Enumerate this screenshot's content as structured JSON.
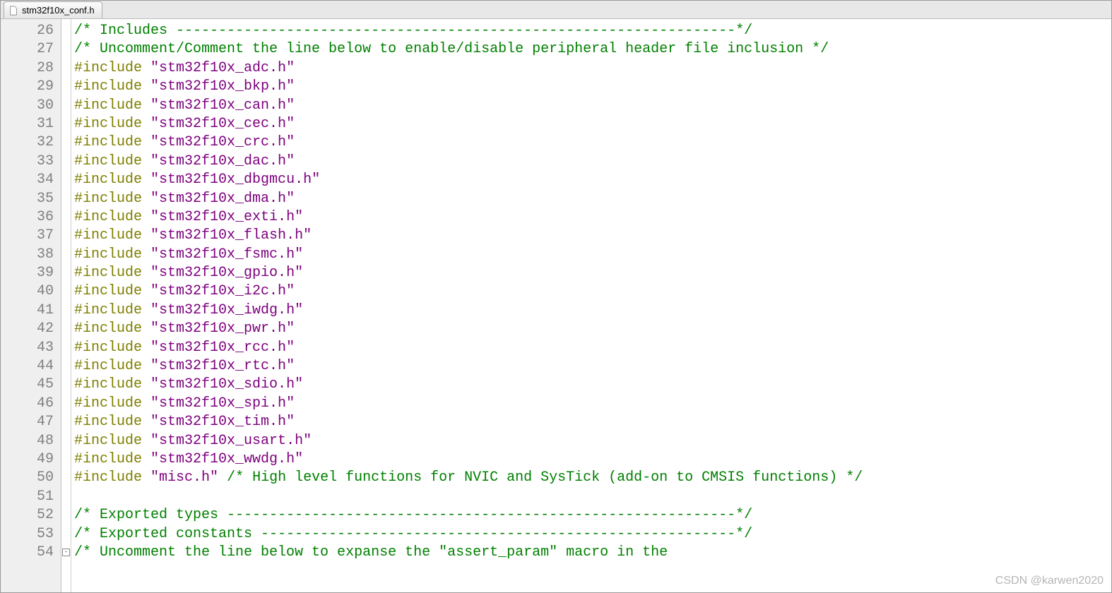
{
  "tab": {
    "filename": "stm32f10x_conf.h"
  },
  "watermark": "CSDN @karwen2020",
  "first_line_number": 26,
  "fold_marker_line": 54,
  "code_lines": [
    {
      "n": 26,
      "tokens": [
        {
          "c": "comment",
          "t": "/* Includes ------------------------------------------------------------------*/"
        }
      ]
    },
    {
      "n": 27,
      "tokens": [
        {
          "c": "comment",
          "t": "/* Uncomment/Comment the line below to enable/disable peripheral header file inclusion */"
        }
      ]
    },
    {
      "n": 28,
      "tokens": [
        {
          "c": "dir",
          "t": "#include "
        },
        {
          "c": "str",
          "t": "\"stm32f10x_adc.h\""
        }
      ]
    },
    {
      "n": 29,
      "tokens": [
        {
          "c": "dir",
          "t": "#include "
        },
        {
          "c": "str",
          "t": "\"stm32f10x_bkp.h\""
        }
      ]
    },
    {
      "n": 30,
      "tokens": [
        {
          "c": "dir",
          "t": "#include "
        },
        {
          "c": "str",
          "t": "\"stm32f10x_can.h\""
        }
      ]
    },
    {
      "n": 31,
      "tokens": [
        {
          "c": "dir",
          "t": "#include "
        },
        {
          "c": "str",
          "t": "\"stm32f10x_cec.h\""
        }
      ]
    },
    {
      "n": 32,
      "tokens": [
        {
          "c": "dir",
          "t": "#include "
        },
        {
          "c": "str",
          "t": "\"stm32f10x_crc.h\""
        }
      ]
    },
    {
      "n": 33,
      "tokens": [
        {
          "c": "dir",
          "t": "#include "
        },
        {
          "c": "str",
          "t": "\"stm32f10x_dac.h\""
        }
      ]
    },
    {
      "n": 34,
      "tokens": [
        {
          "c": "dir",
          "t": "#include "
        },
        {
          "c": "str",
          "t": "\"stm32f10x_dbgmcu.h\""
        }
      ]
    },
    {
      "n": 35,
      "tokens": [
        {
          "c": "dir",
          "t": "#include "
        },
        {
          "c": "str",
          "t": "\"stm32f10x_dma.h\""
        }
      ]
    },
    {
      "n": 36,
      "tokens": [
        {
          "c": "dir",
          "t": "#include "
        },
        {
          "c": "str",
          "t": "\"stm32f10x_exti.h\""
        }
      ]
    },
    {
      "n": 37,
      "tokens": [
        {
          "c": "dir",
          "t": "#include "
        },
        {
          "c": "str",
          "t": "\"stm32f10x_flash.h\""
        }
      ]
    },
    {
      "n": 38,
      "tokens": [
        {
          "c": "dir",
          "t": "#include "
        },
        {
          "c": "str",
          "t": "\"stm32f10x_fsmc.h\""
        }
      ]
    },
    {
      "n": 39,
      "tokens": [
        {
          "c": "dir",
          "t": "#include "
        },
        {
          "c": "str",
          "t": "\"stm32f10x_gpio.h\""
        }
      ]
    },
    {
      "n": 40,
      "tokens": [
        {
          "c": "dir",
          "t": "#include "
        },
        {
          "c": "str",
          "t": "\"stm32f10x_i2c.h\""
        }
      ]
    },
    {
      "n": 41,
      "tokens": [
        {
          "c": "dir",
          "t": "#include "
        },
        {
          "c": "str",
          "t": "\"stm32f10x_iwdg.h\""
        }
      ]
    },
    {
      "n": 42,
      "tokens": [
        {
          "c": "dir",
          "t": "#include "
        },
        {
          "c": "str",
          "t": "\"stm32f10x_pwr.h\""
        }
      ]
    },
    {
      "n": 43,
      "tokens": [
        {
          "c": "dir",
          "t": "#include "
        },
        {
          "c": "str",
          "t": "\"stm32f10x_rcc.h\""
        }
      ]
    },
    {
      "n": 44,
      "tokens": [
        {
          "c": "dir",
          "t": "#include "
        },
        {
          "c": "str",
          "t": "\"stm32f10x_rtc.h\""
        }
      ]
    },
    {
      "n": 45,
      "tokens": [
        {
          "c": "dir",
          "t": "#include "
        },
        {
          "c": "str",
          "t": "\"stm32f10x_sdio.h\""
        }
      ]
    },
    {
      "n": 46,
      "tokens": [
        {
          "c": "dir",
          "t": "#include "
        },
        {
          "c": "str",
          "t": "\"stm32f10x_spi.h\""
        }
      ]
    },
    {
      "n": 47,
      "tokens": [
        {
          "c": "dir",
          "t": "#include "
        },
        {
          "c": "str",
          "t": "\"stm32f10x_tim.h\""
        }
      ]
    },
    {
      "n": 48,
      "tokens": [
        {
          "c": "dir",
          "t": "#include "
        },
        {
          "c": "str",
          "t": "\"stm32f10x_usart.h\""
        }
      ]
    },
    {
      "n": 49,
      "tokens": [
        {
          "c": "dir",
          "t": "#include "
        },
        {
          "c": "str",
          "t": "\"stm32f10x_wwdg.h\""
        }
      ]
    },
    {
      "n": 50,
      "tokens": [
        {
          "c": "dir",
          "t": "#include "
        },
        {
          "c": "str",
          "t": "\"misc.h\""
        },
        {
          "c": "plain",
          "t": " "
        },
        {
          "c": "comment",
          "t": "/* High level functions for NVIC and SysTick (add-on to CMSIS functions) */"
        }
      ]
    },
    {
      "n": 51,
      "tokens": [
        {
          "c": "plain",
          "t": ""
        }
      ]
    },
    {
      "n": 52,
      "tokens": [
        {
          "c": "comment",
          "t": "/* Exported types ------------------------------------------------------------*/"
        }
      ]
    },
    {
      "n": 53,
      "tokens": [
        {
          "c": "comment",
          "t": "/* Exported constants --------------------------------------------------------*/"
        }
      ]
    },
    {
      "n": 54,
      "tokens": [
        {
          "c": "comment",
          "t": "/* Uncomment the line below to expanse the \"assert_param\" macro in the"
        }
      ]
    }
  ]
}
